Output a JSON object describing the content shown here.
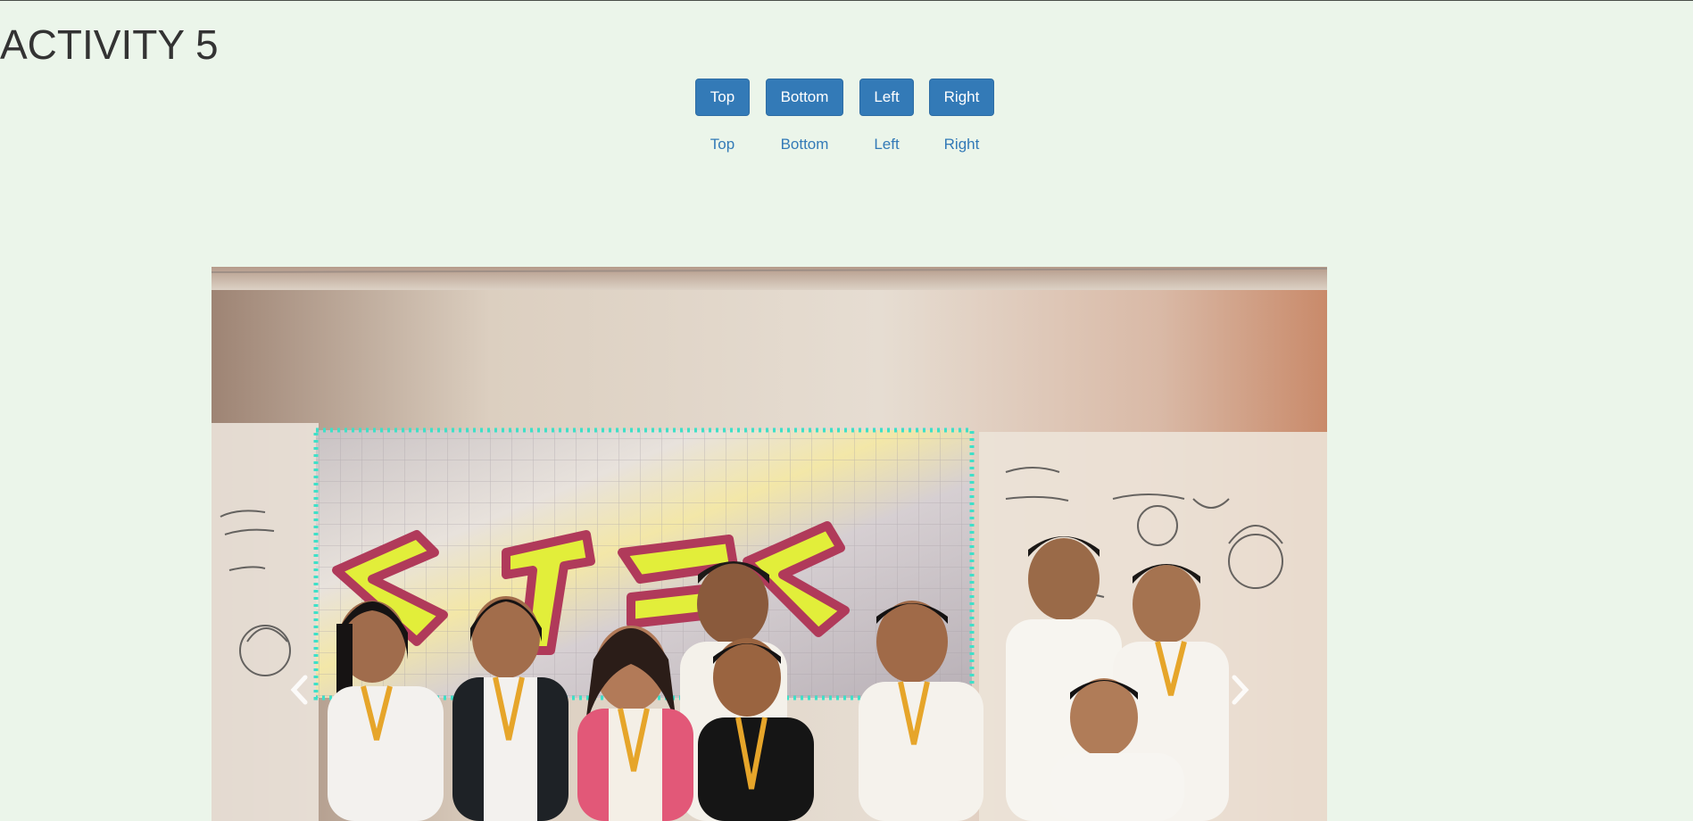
{
  "page": {
    "title": "ACTIVITY 5"
  },
  "tooltip_buttons": [
    {
      "label": "Top"
    },
    {
      "label": "Bottom"
    },
    {
      "label": "Left"
    },
    {
      "label": "Right"
    }
  ],
  "tooltip_links": [
    {
      "label": "Top"
    },
    {
      "label": "Bottom"
    },
    {
      "label": "Left"
    },
    {
      "label": "Right"
    }
  ],
  "carousel": {
    "active_slide": {
      "description_icon": "group-photo"
    },
    "prev_icon": "chevron-left-icon",
    "next_icon": "chevron-right-icon"
  },
  "colors": {
    "background": "#ebf5ea",
    "primary": "#337ab7",
    "text": "#333333"
  }
}
